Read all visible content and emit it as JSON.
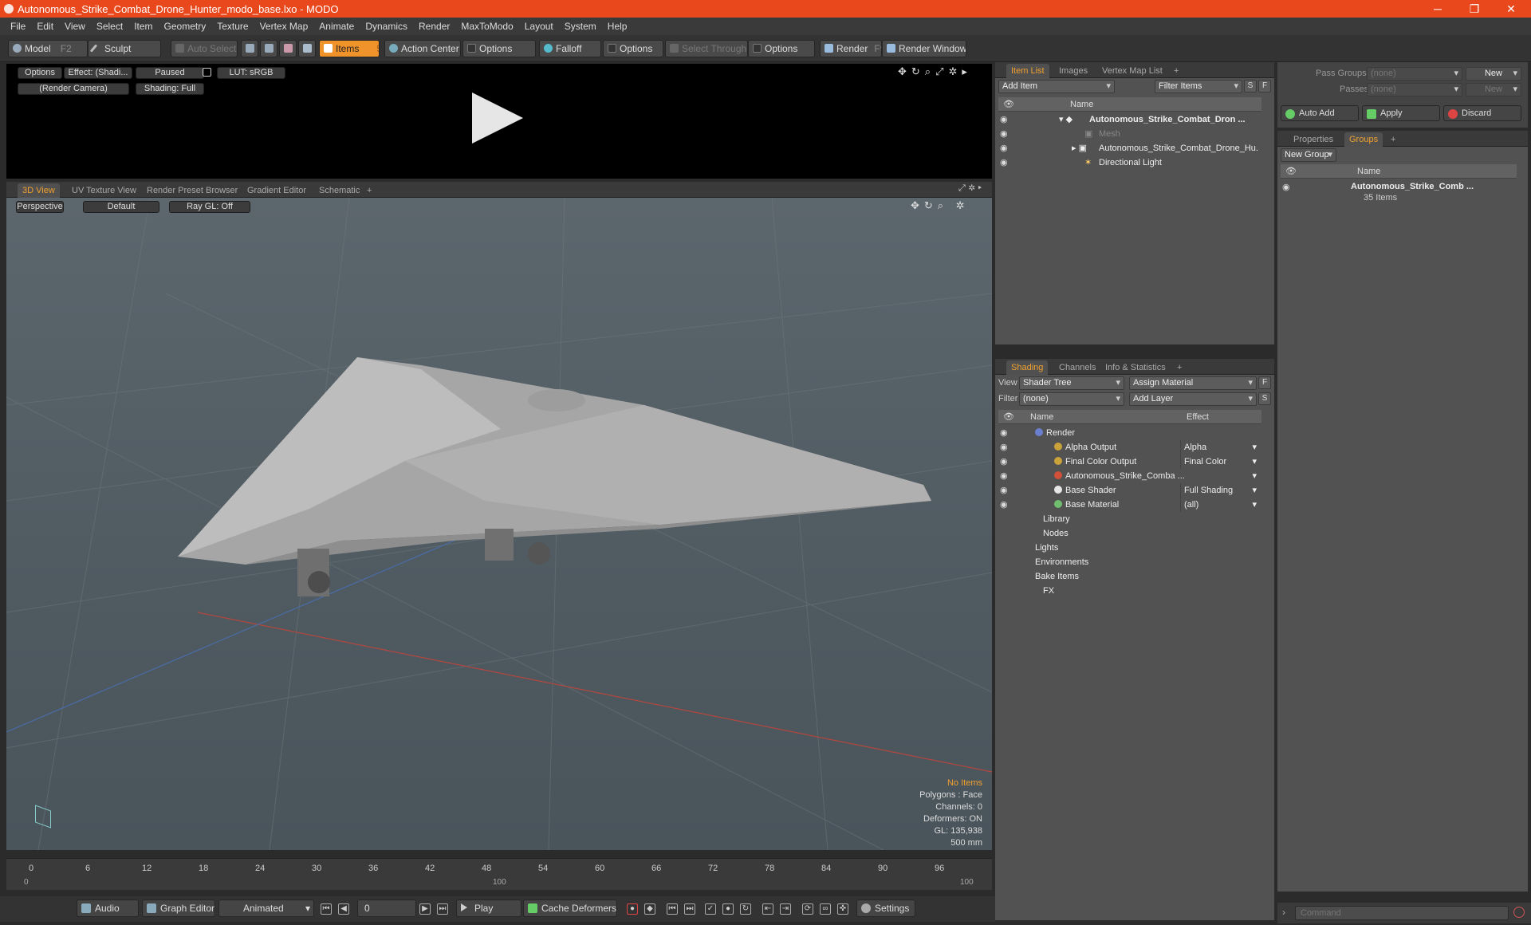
{
  "window": {
    "title": "Autonomous_Strike_Combat_Drone_Hunter_modo_base.lxo - MODO",
    "minimize": "─",
    "maximize": "❐",
    "close": "✕"
  },
  "menu": [
    "File",
    "Edit",
    "View",
    "Select",
    "Item",
    "Geometry",
    "Texture",
    "Vertex Map",
    "Animate",
    "Dynamics",
    "Render",
    "MaxToModo",
    "Layout",
    "System",
    "Help"
  ],
  "toolbar": {
    "model": "Model",
    "model_key": "F2",
    "sculpt": "Sculpt",
    "auto_select": "Auto Select",
    "items": "Items",
    "items_key": "5",
    "action_center": "Action Center",
    "options1": "Options",
    "falloff": "Falloff",
    "options2": "Options",
    "select_through": "Select Through",
    "options3": "Options",
    "render": "Render",
    "render_key": "F9",
    "render_window": "Render Window"
  },
  "preview": {
    "options": "Options",
    "effect": "Effect: (Shadi...",
    "paused": "Paused",
    "lut": "LUT: sRGB",
    "camera": "(Render Camera)",
    "shading": "Shading: Full"
  },
  "view_tabs": [
    "3D View",
    "UV Texture View",
    "Render Preset Browser",
    "Gradient Editor",
    "Schematic",
    "+"
  ],
  "viewport": {
    "perspective": "Perspective",
    "default": "Default",
    "raygl": "Ray GL: Off"
  },
  "hud": {
    "no_items": "No Items",
    "polygons": "Polygons : Face",
    "channels": "Channels: 0",
    "deformers": "Deformers: ON",
    "gl": "GL: 135,938",
    "scale": "500 mm"
  },
  "timeline": {
    "ticks": [
      "0",
      "6",
      "12",
      "18",
      "24",
      "30",
      "36",
      "42",
      "48",
      "54",
      "60",
      "66",
      "72",
      "78",
      "84",
      "90",
      "96"
    ],
    "lower": [
      "0",
      "100",
      "100"
    ]
  },
  "bottom": {
    "audio": "Audio",
    "graph_editor": "Graph Editor",
    "animated": "Animated",
    "frame": "0",
    "play": "Play",
    "cache": "Cache Deformers",
    "settings": "Settings"
  },
  "itemlist": {
    "tabs": [
      "Item List",
      "Images",
      "Vertex Map List",
      "+"
    ],
    "add_item": "Add Item",
    "filter": "Filter Items",
    "s": "S",
    "f": "F",
    "col_name": "Name",
    "rows": [
      {
        "label": "Autonomous_Strike_Combat_Dron ...",
        "bold": true
      },
      {
        "label": "Mesh",
        "dim": true
      },
      {
        "label": "Autonomous_Strike_Combat_Drone_Hu..."
      },
      {
        "label": "Directional Light"
      }
    ]
  },
  "shading": {
    "tabs": [
      "Shading",
      "Channels",
      "Info & Statistics",
      "+"
    ],
    "view_label": "View",
    "view_value": "Shader Tree",
    "assign": "Assign Material",
    "f": "F",
    "filter_label": "Filter",
    "filter_value": "(none)",
    "add_layer": "Add Layer",
    "s": "S",
    "col_name": "Name",
    "col_effect": "Effect",
    "rows": [
      {
        "label": "Render",
        "effect": ""
      },
      {
        "label": "Alpha Output",
        "effect": "Alpha"
      },
      {
        "label": "Final Color Output",
        "effect": "Final Color"
      },
      {
        "label": "Autonomous_Strike_Comba ...",
        "effect": ""
      },
      {
        "label": "Base Shader",
        "effect": "Full Shading"
      },
      {
        "label": "Base Material",
        "effect": "(all)"
      },
      {
        "label": "Library",
        "effect": ""
      },
      {
        "label": "Nodes",
        "effect": ""
      },
      {
        "label": "Lights",
        "effect": ""
      },
      {
        "label": "Environments",
        "effect": ""
      },
      {
        "label": "Bake Items",
        "effect": ""
      },
      {
        "label": "FX",
        "effect": ""
      }
    ]
  },
  "passes": {
    "pass_groups": "Pass Groups",
    "pass_value": "(none)",
    "new": "New",
    "passes": "Passes",
    "passes_value": "(none)",
    "new2": "New",
    "auto_add": "Auto Add",
    "apply": "Apply",
    "discard": "Discard"
  },
  "groups": {
    "tabs": [
      "Properties",
      "Groups",
      "+"
    ],
    "new_group": "New Group",
    "col_name": "Name",
    "group_name": "Autonomous_Strike_Comb ...",
    "group_count": "35 Items"
  },
  "command": {
    "placeholder": "Command"
  },
  "colors": {
    "accent": "#f0932a",
    "titlebar": "#e8481c"
  }
}
